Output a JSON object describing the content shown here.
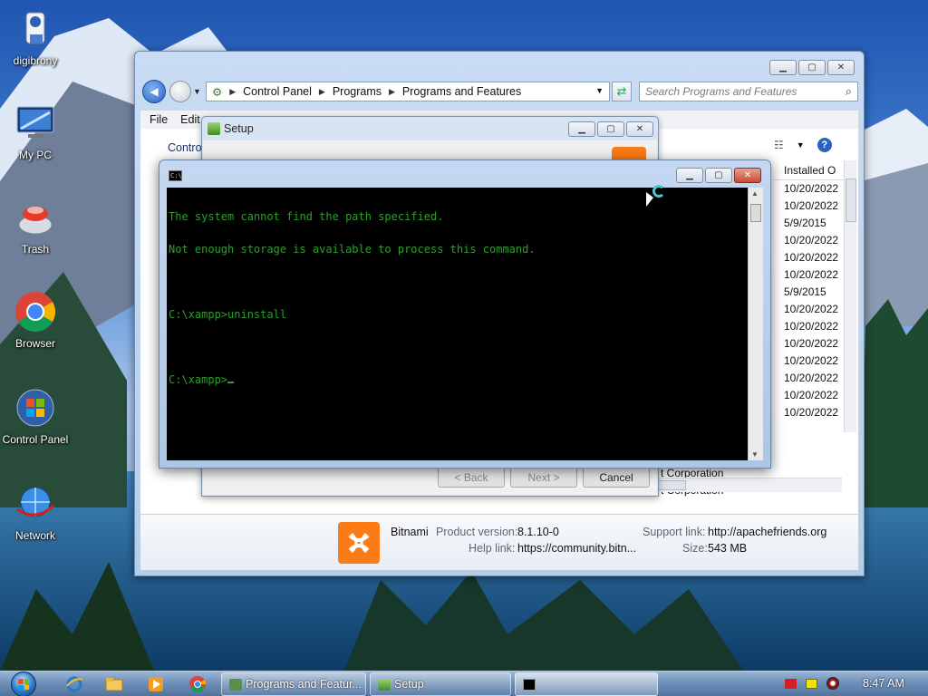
{
  "desktop": {
    "icons": [
      {
        "label": "digibrony"
      },
      {
        "label": "My PC"
      },
      {
        "label": "Trash"
      },
      {
        "label": "Browser"
      },
      {
        "label": "Control Panel"
      },
      {
        "label": "Network"
      }
    ]
  },
  "explorer": {
    "breadcrumbs": [
      "Control Panel",
      "Programs",
      "Programs and Features"
    ],
    "search_placeholder": "Search Programs and Features",
    "menu": [
      "File",
      "Edit"
    ],
    "left_link": "Contro",
    "column_header": "Installed O",
    "installed_dates": [
      "10/20/2022",
      "10/20/2022",
      "5/9/2015",
      "10/20/2022",
      "10/20/2022",
      "10/20/2022",
      "5/9/2015",
      "10/20/2022",
      "10/20/2022",
      "10/20/2022",
      "10/20/2022",
      "10/20/2022",
      "10/20/2022",
      "10/20/2022"
    ],
    "publisher_rows": [
      "t Corporation",
      "t Corporation"
    ],
    "details": {
      "name": "Bitnami",
      "product_version_label": "Product version:",
      "product_version": "8.1.10-0",
      "help_link_label": "Help link:",
      "help_link": "https://community.bitn...",
      "support_link_label": "Support link:",
      "support_link": "http://apachefriends.org",
      "size_label": "Size:",
      "size": "543 MB"
    }
  },
  "setup": {
    "title": "Setup",
    "buttons": {
      "back": "< Back",
      "next": "Next >",
      "cancel": "Cancel"
    }
  },
  "console": {
    "lines": [
      "The system cannot find the path specified.",
      "Not enough storage is available to process this command.",
      "",
      "C:\\xampp>uninstall",
      "",
      "C:\\xampp>"
    ],
    "text_color": "#2e9e2e"
  },
  "taskbar": {
    "items": [
      {
        "label": "Programs and Featur..."
      },
      {
        "label": "Setup"
      },
      {
        "label": ""
      }
    ],
    "clock": "8:47 AM"
  }
}
